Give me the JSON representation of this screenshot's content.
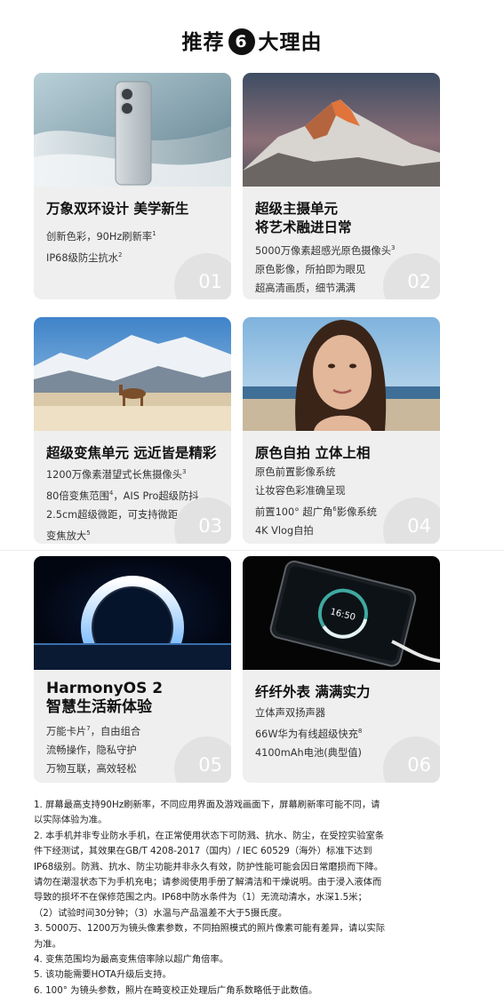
{
  "header": {
    "title_left": "推荐",
    "title_num": "6",
    "title_right": "大理由"
  },
  "cards": [
    {
      "num": "01",
      "title": "万象双环设计 美学新生",
      "lines": [
        {
          "text": "创新色彩，90Hz刷新率",
          "sup": "1"
        },
        {
          "text": "IP68级防尘抗水",
          "sup": "2"
        }
      ]
    },
    {
      "num": "02",
      "title1": "超级主摄单元",
      "title2": "将艺术融进日常",
      "lines": [
        {
          "text": "5000万像素超感光原色摄像头",
          "sup": "3"
        },
        {
          "text": "原色影像，所拍即为眼见",
          "sup": ""
        },
        {
          "text": "超高清画质，细节满满",
          "sup": ""
        }
      ]
    },
    {
      "num": "03",
      "title": "超级变焦单元 远近皆是精彩",
      "lines": [
        {
          "text": "1200万像素潜望式长焦摄像头",
          "sup": "3"
        },
        {
          "text": "80倍变焦范围",
          "sup": "4",
          "after": "，AIS Pro超级防抖"
        },
        {
          "text": "2.5cm超级微距，可支持微距",
          "sup": ""
        },
        {
          "text": "变焦放大",
          "sup": "5"
        }
      ]
    },
    {
      "num": "04",
      "title": "原色自拍 立体上相",
      "lines": [
        {
          "text": "原色前置影像系统",
          "sup": ""
        },
        {
          "text": "让妆容色彩准确呈现",
          "sup": ""
        },
        {
          "text": "前置100° 超广角",
          "sup": "6",
          "after": "影像系统"
        },
        {
          "text": "4K Vlog自拍",
          "sup": ""
        }
      ]
    },
    {
      "num": "05",
      "title1": "HarmonyOS 2",
      "title2": "智慧生活新体验",
      "lines": [
        {
          "text": "万能卡片",
          "sup": "7",
          "after": "，自由组合"
        },
        {
          "text": "流畅操作，隐私守护",
          "sup": ""
        },
        {
          "text": "万物互联，高效轻松",
          "sup": ""
        }
      ]
    },
    {
      "num": "06",
      "title": "纤纤外表  满满实力",
      "lines": [
        {
          "text": "立体声双扬声器",
          "sup": ""
        },
        {
          "text": "66W华为有线超级快充",
          "sup": "8"
        },
        {
          "text": "4100mAh电池(典型值)",
          "sup": ""
        }
      ]
    }
  ],
  "phone_screen": {
    "time": "16:50"
  },
  "notes": [
    "1. 屏幕最高支持90Hz刷新率，不同应用界面及游戏画面下，屏幕刷新率可能不同，请",
    "以实际体验为准。",
    "2. 本手机并非专业防水手机，在正常使用状态下可防溅、抗水、防尘，在受控实验室条",
    "件下经测试，其效果在GB/T 4208-2017（国内）/ IEC 60529（海外）标准下达到",
    "IP68级别。防溅、抗水、防尘功能并非永久有效，防护性能可能会因日常磨损而下降。",
    "请勿在潮湿状态下为手机充电；请参阅使用手册了解清洁和干燥说明。由于浸入液体而",
    "导致的损坏不在保修范围之内。IP68中防水条件为（1）无流动清水，水深1.5米；",
    "（2）试验时间30分钟；（3）水温与产品温差不大于5摄氏度。",
    "3. 5000万、1200万为镜头像素参数，不同拍照模式的照片像素可能有差异，请以实际",
    "为准。",
    "4. 变焦范围均为最高变焦倍率除以超广角倍率。",
    "5. 该功能需要HOTA升级后支持。",
    "6. 100° 为镜头参数，照片在畸变校正处理后广角系数略低于此数值。"
  ]
}
